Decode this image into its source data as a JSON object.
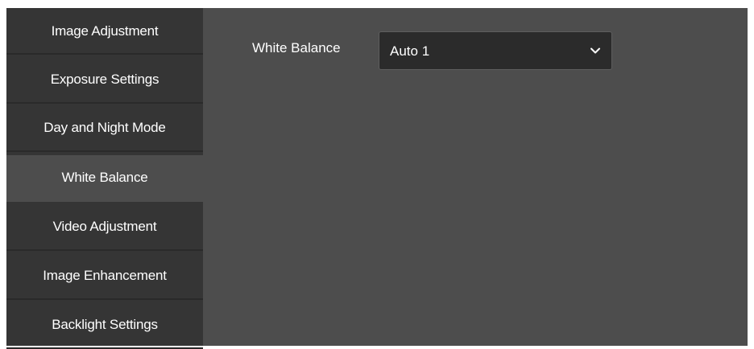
{
  "sidebar": {
    "items": [
      {
        "label": "Image Adjustment",
        "active": false
      },
      {
        "label": "Exposure Settings",
        "active": false
      },
      {
        "label": "Day and Night Mode",
        "active": false
      },
      {
        "label": "White Balance",
        "active": true
      },
      {
        "label": "Video Adjustment",
        "active": false
      },
      {
        "label": "Image Enhancement",
        "active": false
      },
      {
        "label": "Backlight Settings",
        "active": false
      }
    ]
  },
  "main": {
    "white_balance": {
      "label": "White Balance",
      "selected_value": "Auto 1",
      "icon": "chevron-down-icon"
    }
  },
  "colors": {
    "background": "#4d4d4d",
    "sidebar": "#353535",
    "select_background": "#2b2b2b",
    "text": "#ffffff"
  }
}
